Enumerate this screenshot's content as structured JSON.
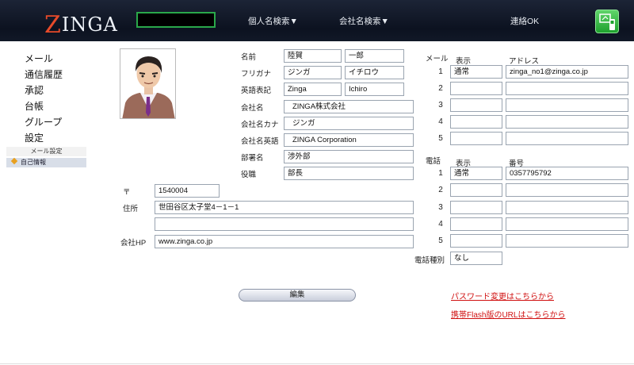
{
  "header": {
    "logo_initial": "Z",
    "logo_rest": "INGA",
    "nav_person": "個人名検索▼",
    "nav_company": "会社名検索▼",
    "nav_contact": "連絡OK",
    "phone_icon": "mobile-phone-icon"
  },
  "sidebar": {
    "items": [
      "メール",
      "通信履歴",
      "承認",
      "台帳",
      "グループ",
      "設定"
    ],
    "sub_mail_settings": "メール設定",
    "sub_self_info": "自己情報"
  },
  "profile": {
    "name_label": "名前",
    "last_name": "陸賀",
    "first_name": "一郎",
    "kana_label": "フリガナ",
    "last_kana": "ジンガ",
    "first_kana": "イチロウ",
    "eng_label": "英語表記",
    "last_eng": "Zinga",
    "first_eng": "Ichiro",
    "company_label": "会社名",
    "company": "ZINGA株式会社",
    "company_kana_label": "会社名カナ",
    "company_kana": "ジンガ",
    "company_eng_label": "会社名英語",
    "company_eng": "ZINGA Corporation",
    "dept_label": "部署名",
    "dept": "渉外部",
    "title_label": "役職",
    "title": "部長",
    "zip_label": "〒",
    "zip": "1540004",
    "address_label": "住所",
    "address1": "世田谷区太子堂4－1－1",
    "address2": "",
    "hp_label": "会社HP",
    "hp": "www.zinga.co.jp"
  },
  "mail": {
    "section_label": "メール",
    "col_display": "表示",
    "col_address": "アドレス",
    "rows": [
      {
        "num": "1",
        "display": "通常",
        "address": "zinga_no1@zinga.co.jp"
      },
      {
        "num": "2",
        "display": "",
        "address": ""
      },
      {
        "num": "3",
        "display": "",
        "address": ""
      },
      {
        "num": "4",
        "display": "",
        "address": ""
      },
      {
        "num": "5",
        "display": "",
        "address": ""
      }
    ]
  },
  "phone": {
    "section_label": "電話",
    "col_display": "表示",
    "col_number": "番号",
    "rows": [
      {
        "num": "1",
        "display": "通常",
        "number": "0357795792"
      },
      {
        "num": "2",
        "display": "",
        "number": ""
      },
      {
        "num": "3",
        "display": "",
        "number": ""
      },
      {
        "num": "4",
        "display": "",
        "number": ""
      },
      {
        "num": "5",
        "display": "",
        "number": ""
      }
    ],
    "type_label": "電話種別",
    "type_value": "なし"
  },
  "actions": {
    "edit_label": "編集",
    "password_link": "パスワード変更はこちらから",
    "flash_link": "携帯Flash版のURLはこちらから"
  },
  "colors": {
    "header_bg": "#0c1220",
    "logo_accent": "#e74a2a",
    "link": "#d01010"
  }
}
